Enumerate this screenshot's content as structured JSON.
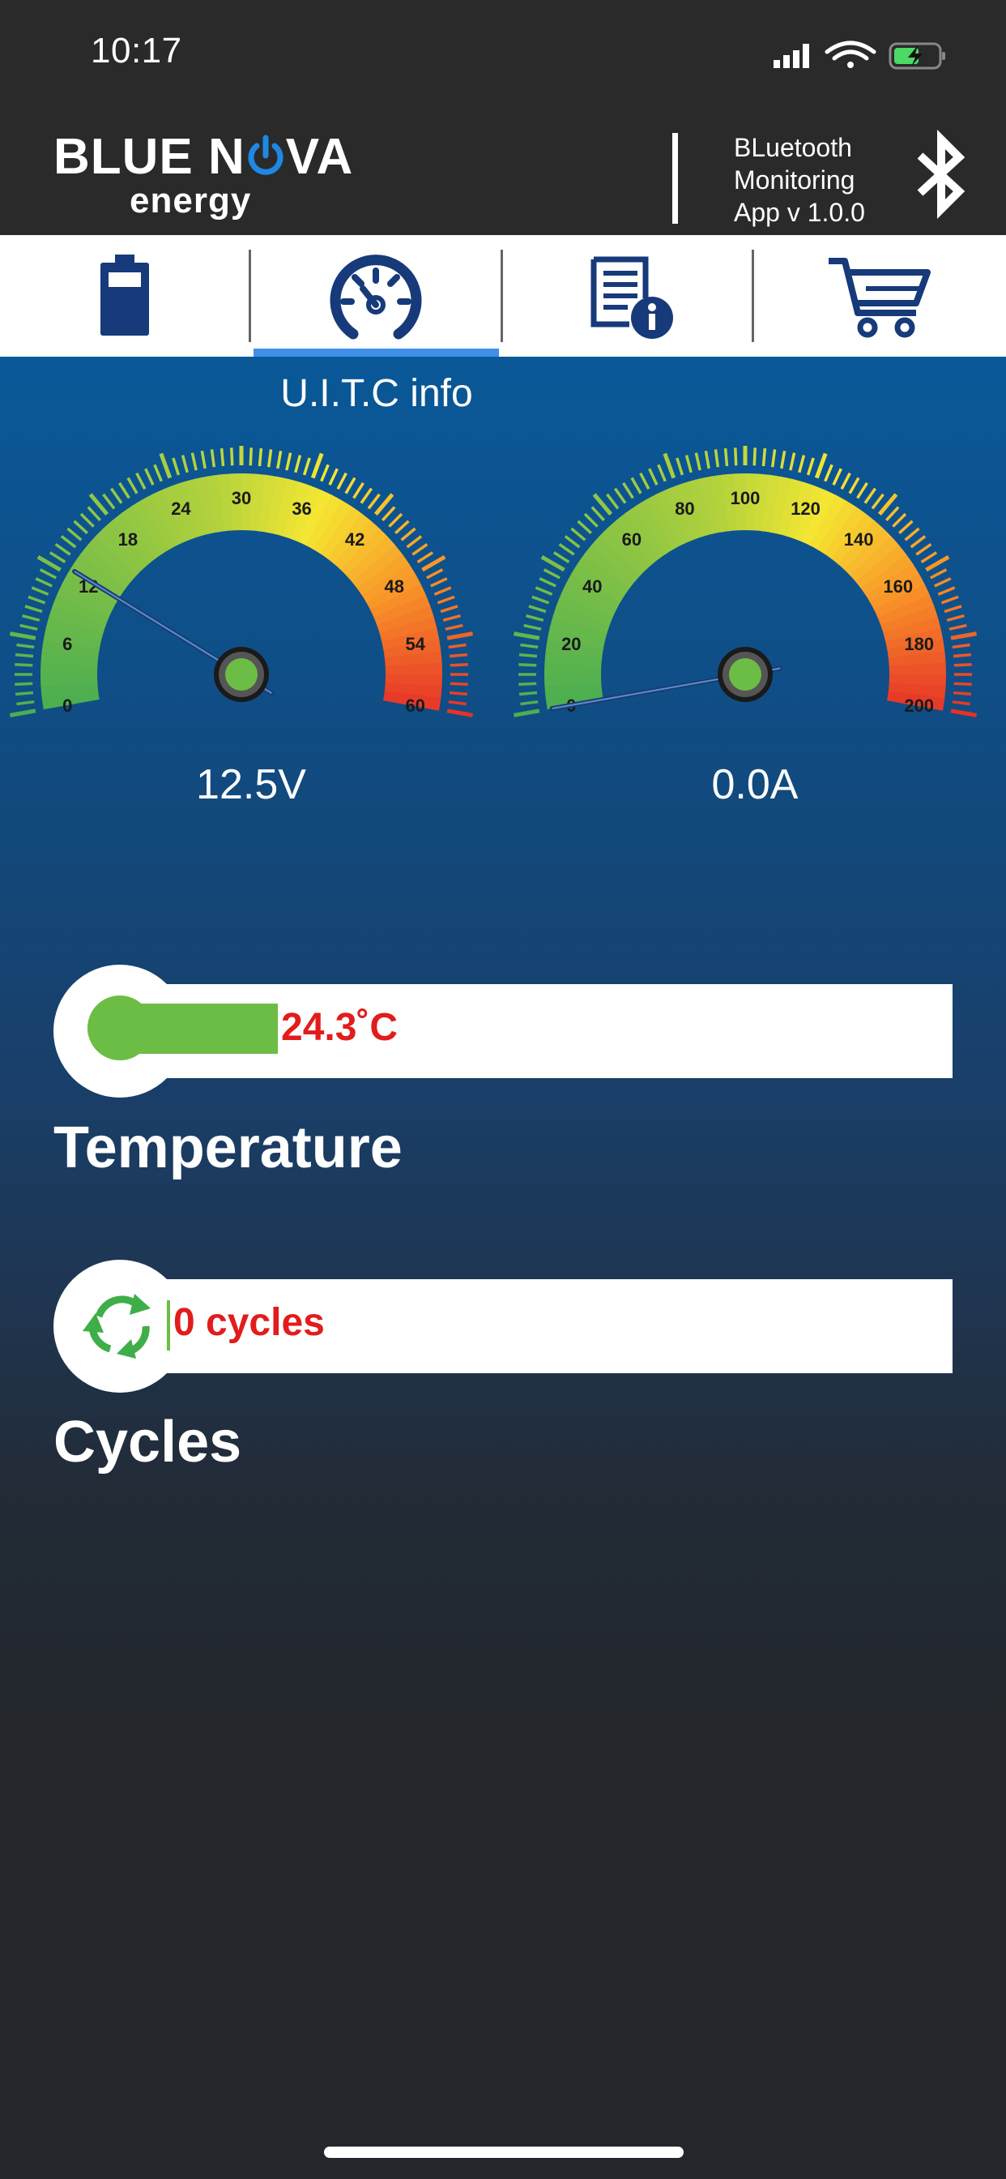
{
  "status_bar": {
    "time": "10:17"
  },
  "header": {
    "brand_top": "BLUE N",
    "brand_mid": "VA",
    "brand_sub": "energy",
    "app_info_lines": [
      "BLuetooth",
      "Monitoring",
      "App v 1.0.0"
    ]
  },
  "tabs": [
    {
      "icon": "battery-icon",
      "active": false
    },
    {
      "icon": "gauge-icon",
      "active": true
    },
    {
      "icon": "document-info-icon",
      "active": false
    },
    {
      "icon": "cart-icon",
      "active": false
    }
  ],
  "colors": {
    "accent": "#3f8fe8",
    "navy": "#173a7a",
    "alert_text": "#e21c1c",
    "fill_green": "#6cbd45"
  },
  "section": {
    "title": "U.I.T.C info"
  },
  "gauges": {
    "voltage": {
      "ticks": [
        "0",
        "6",
        "12",
        "18",
        "24",
        "30",
        "36",
        "42",
        "48",
        "54",
        "60"
      ],
      "min": 0,
      "max": 60,
      "needle_value": 12.5,
      "readout": "12.5V"
    },
    "current": {
      "ticks": [
        "0",
        "20",
        "40",
        "60",
        "80",
        "100",
        "120",
        "140",
        "160",
        "180",
        "200"
      ],
      "min": 0,
      "max": 200,
      "needle_value": 0,
      "readout": "0.0A"
    }
  },
  "temperature": {
    "value_text": "24.3˚C",
    "label": "Temperature",
    "fill_fraction": 0.22
  },
  "cycles": {
    "value_text": "0 cycles",
    "label": "Cycles"
  }
}
